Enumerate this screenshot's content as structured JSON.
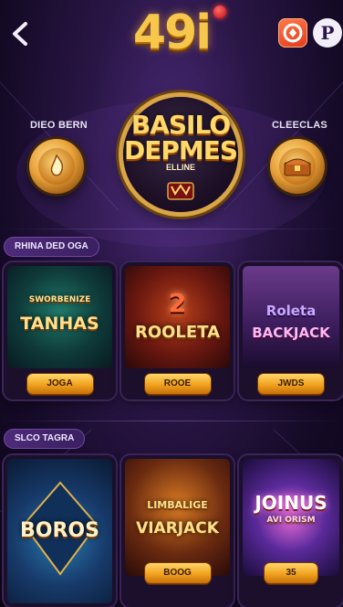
{
  "header": {
    "logo_text": "49i",
    "back_icon": "chevron-left-icon",
    "app_icon_1": "rewards-app-icon",
    "app_icon_2": "p-app-icon",
    "app_icon_2_letter": "P"
  },
  "hero": {
    "left_label": "DIEO BERN",
    "right_label": "CLEECLAS",
    "center_title_line1": "BASILO",
    "center_title_line2": "DEPMES",
    "center_subtitle": "ELLINE",
    "colors": {
      "gold": "#f6c74a",
      "purple": "#2a1646"
    }
  },
  "sections": [
    {
      "label": "RHINA DED OGA",
      "games": [
        {
          "title": "TANHAS",
          "title_top": "SWORBENIZE",
          "button": "JOGA"
        },
        {
          "title": "ROOLETA",
          "title_top": "2",
          "button": "ROOE"
        },
        {
          "title": "BACKJACK",
          "title_top": "Roleta",
          "button": "JWDS"
        }
      ]
    },
    {
      "label": "SLCO TAGRA",
      "games": [
        {
          "title": "BOROS",
          "title_top": "",
          "button": ""
        },
        {
          "title": "VIARJACK",
          "title_top": "LIMBALIGE",
          "button": "BOOG"
        },
        {
          "title": "JOINUS",
          "title_top": "",
          "subtitle": "AVI ORISM",
          "button": "35"
        }
      ]
    }
  ]
}
